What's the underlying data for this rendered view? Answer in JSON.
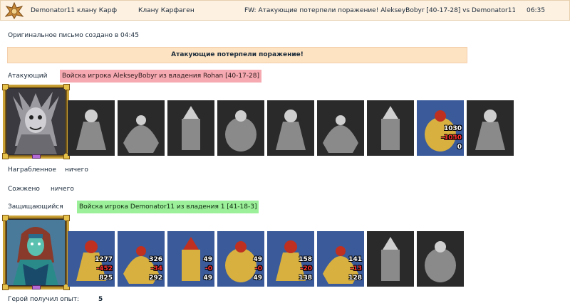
{
  "header": {
    "from": "Demonator11 клану Карф",
    "to": "Клану Карфаген",
    "subject": "FW: Атакующие потерпели поражение! AlekseyBobyr [40-17-28] vs Demonator11 [41-18-3]",
    "time": "06:35",
    "logo_icon": "castle-emblem-icon"
  },
  "message": {
    "created_text": "Оригинальное письмо создано в 04:45",
    "result_banner": "Атакующие потерпели поражение!"
  },
  "attacker": {
    "label": "Атакующий",
    "army_text": "Войска игрока AlekseyBobyr из владения Rohan [40-17-28]",
    "tag_color": "#f6a9b1",
    "hero_icon": "dark-demon-hero-portrait",
    "units": [
      {
        "icon": "bone-dragon-unit-icon",
        "total": "",
        "lost": "",
        "left": ""
      },
      {
        "icon": "skeleton-warrior-unit-icon",
        "total": "",
        "lost": "",
        "left": ""
      },
      {
        "icon": "zombie-unit-icon",
        "total": "",
        "lost": "",
        "left": ""
      },
      {
        "icon": "ghost-unit-icon",
        "total": "",
        "lost": "",
        "left": ""
      },
      {
        "icon": "gargoyle-unit-icon",
        "total": "",
        "lost": "",
        "left": ""
      },
      {
        "icon": "shadow-beast-unit-icon",
        "total": "",
        "lost": "",
        "left": ""
      },
      {
        "icon": "ghoul-unit-icon",
        "total": "",
        "lost": "",
        "left": ""
      },
      {
        "icon": "fire-demon-unit-icon",
        "total": "1030",
        "lost": "-1030",
        "left": "0"
      },
      {
        "icon": "wraith-unit-icon",
        "total": "",
        "lost": "",
        "left": ""
      }
    ]
  },
  "loot": {
    "plundered_label": "Награбленное",
    "plundered_value": "ничего",
    "burned_label": "Сожжено",
    "burned_value": "ничего"
  },
  "defender": {
    "label": "Защищающийся",
    "army_text": "Войска игрока Demonator11 из владения 1 [41-18-3]",
    "tag_color": "#9cf09a",
    "hero_icon": "green-elf-hero-portrait",
    "units": [
      {
        "icon": "peasant-cart-unit-icon",
        "total": "1277",
        "lost": "-452",
        "left": "825"
      },
      {
        "icon": "golden-archer-unit-icon",
        "total": "326",
        "lost": "-34",
        "left": "292"
      },
      {
        "icon": "cavalry-unit-icon",
        "total": "49",
        "lost": "-0",
        "left": "49"
      },
      {
        "icon": "pegasus-unit-icon",
        "total": "49",
        "lost": "-0",
        "left": "49"
      },
      {
        "icon": "crossbowman-unit-icon",
        "total": "158",
        "lost": "-20",
        "left": "138"
      },
      {
        "icon": "mage-unit-icon",
        "total": "141",
        "lost": "-13",
        "left": "128"
      },
      {
        "icon": "knight-unit-icon",
        "total": "",
        "lost": "",
        "left": ""
      },
      {
        "icon": "archangel-unit-icon",
        "total": "",
        "lost": "",
        "left": ""
      }
    ]
  },
  "experience": {
    "label": "Герой получил опыт:",
    "value": "5"
  }
}
